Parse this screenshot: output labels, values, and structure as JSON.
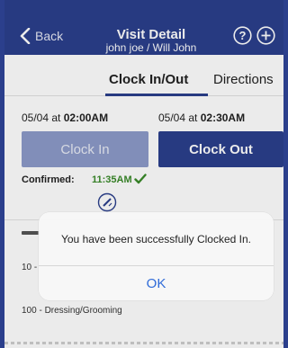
{
  "navbar": {
    "back_label": "Back",
    "title": "Visit Detail",
    "subtitle": "john joe / Will John",
    "bg_color": "#2b3f8c"
  },
  "tabs": [
    {
      "label": "Clock In/Out",
      "active": true
    },
    {
      "label": "Directions",
      "active": false
    }
  ],
  "clock_in": {
    "date": "05/04 at",
    "time": "02:00AM",
    "button_label": "Clock In"
  },
  "clock_out": {
    "date": "05/04 at",
    "time": "02:30AM",
    "button_label": "Clock Out"
  },
  "confirmation": {
    "label": "Confirmed:",
    "time": "11:35AM",
    "accent_color": "#3a8a2a"
  },
  "tasks": [
    {
      "label": "10 -"
    },
    {
      "label": "100 - Dressing/Grooming"
    }
  ],
  "alert": {
    "message": "You have been successfully Clocked In.",
    "ok_label": "OK",
    "ok_color": "#2f6bd8"
  }
}
